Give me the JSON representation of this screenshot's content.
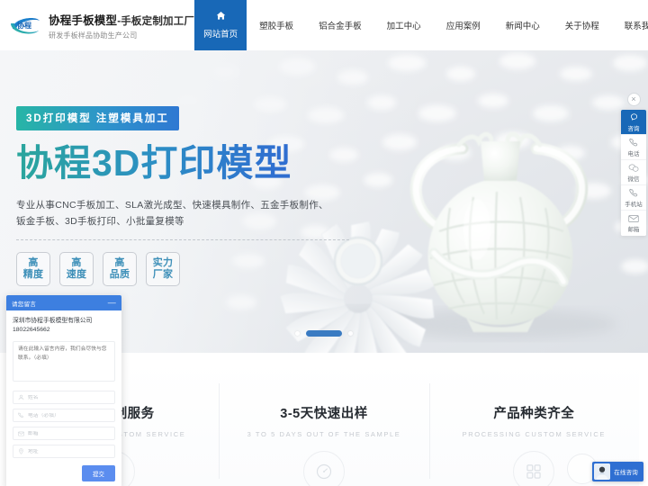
{
  "header": {
    "logo_name": "协程",
    "title_main": "协程手板模型",
    "title_suffix": "-手板定制加工厂",
    "subtitle": "研发手板样品协助生产公司",
    "nav": [
      {
        "label": "网站首页",
        "icon": "home-icon",
        "active": true
      },
      {
        "label": "塑胶手板",
        "active": false
      },
      {
        "label": "铝合金手板",
        "active": false
      },
      {
        "label": "加工中心",
        "active": false
      },
      {
        "label": "应用案例",
        "active": false
      },
      {
        "label": "新闻中心",
        "active": false
      },
      {
        "label": "关于协程",
        "active": false
      },
      {
        "label": "联系我们",
        "active": false
      }
    ],
    "phone_icon": "phone-icon"
  },
  "hero": {
    "tag": "3D打印模型  注塑模具加工",
    "title": "协程3D打印模型",
    "desc_line1": "专业从事CNC手板加工、SLA激光成型、快速模具制作、五金手板制作、",
    "desc_line2": "钣金手板、3D手板打印、小批量复模等",
    "badges": [
      {
        "top": "高",
        "bottom": "精度"
      },
      {
        "top": "高",
        "bottom": "速度"
      },
      {
        "top": "高",
        "bottom": "品质"
      },
      {
        "top": "实力",
        "bottom": "厂家"
      }
    ],
    "carousel": {
      "slides": 3,
      "active_index": 1
    },
    "image_alt": "3d-printed-vase-and-turbine"
  },
  "cards": [
    {
      "title": "加工定制服务",
      "subtitle": "PROCESSING CUSTOM SERVICE",
      "icon": "gear-icon"
    },
    {
      "title": "3-5天快速出样",
      "subtitle": "3 TO 5 DAYS OUT OF THE SAMPLE",
      "icon": "speedometer-icon"
    },
    {
      "title": "产品种类齐全",
      "subtitle": "PROCESSING CUSTOM SERVICE",
      "icon": "grid-icon"
    }
  ],
  "floatbar": {
    "close_label": "×",
    "items": [
      {
        "label": "咨询",
        "icon": "chat-bubble-icon",
        "active": true
      },
      {
        "label": "电话",
        "icon": "phone-icon",
        "active": false
      },
      {
        "label": "微信",
        "icon": "wechat-icon",
        "active": false
      },
      {
        "label": "手机站",
        "icon": "mobile-phone-icon",
        "active": false
      },
      {
        "label": "邮箱",
        "icon": "envelope-icon",
        "active": false
      }
    ]
  },
  "message_box": {
    "title": "请您留言",
    "minimize_label": "—",
    "company_line": "深圳市协程手板模型有限公司18022645662",
    "textarea_placeholder": "请在此输入留言内容，我们会尽快与您联系。（必填）",
    "textarea_value": "",
    "fields": [
      {
        "name": "name",
        "placeholder": "姓名",
        "value": "",
        "icon": "user-icon"
      },
      {
        "name": "phone",
        "placeholder": "电话（必填）",
        "value": "",
        "icon": "phone-icon"
      },
      {
        "name": "email",
        "placeholder": "邮箱",
        "value": "",
        "icon": "envelope-icon"
      },
      {
        "name": "address",
        "placeholder": "地址",
        "value": "",
        "icon": "location-icon"
      }
    ],
    "submit_label": "提交"
  },
  "chat_widget": {
    "label": "在线咨询",
    "avatar_alt": "support-agent-avatar"
  },
  "colors": {
    "brand_blue": "#1868b7",
    "accent_blue": "#3d7fe0",
    "teal": "#27b5a6",
    "text_dark": "#262b31",
    "muted": "#c6cad0"
  }
}
